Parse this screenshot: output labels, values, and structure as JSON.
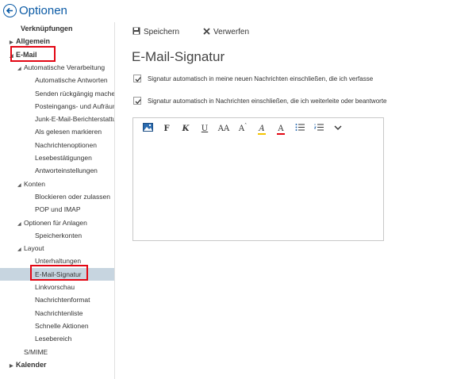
{
  "header": {
    "title": "Optionen"
  },
  "sidebar": {
    "items": [
      {
        "label": "Verknüpfungen",
        "level": 0,
        "bold": true,
        "arrow": "",
        "top": 0
      },
      {
        "label": "Allgemein",
        "level": 0,
        "bold": true,
        "arrow": "▶"
      },
      {
        "label": "E-Mail",
        "level": 0,
        "bold": true,
        "arrow": "◢"
      },
      {
        "label": "Automatische Verarbeitung",
        "level": 1,
        "arrow": "◢"
      },
      {
        "label": "Automatische Antworten",
        "level": 2
      },
      {
        "label": "Senden rückgängig machen",
        "level": 2
      },
      {
        "label": "Posteingangs- und Aufräumregeln",
        "level": 2
      },
      {
        "label": "Junk-E-Mail-Berichterstattung",
        "level": 2
      },
      {
        "label": "Als gelesen markieren",
        "level": 2
      },
      {
        "label": "Nachrichtenoptionen",
        "level": 2
      },
      {
        "label": "Lesebestätigungen",
        "level": 2
      },
      {
        "label": "Antworteinstellungen",
        "level": 2
      },
      {
        "label": "Konten",
        "level": 1,
        "arrow": "◢"
      },
      {
        "label": "Blockieren oder zulassen",
        "level": 2
      },
      {
        "label": "POP und IMAP",
        "level": 2
      },
      {
        "label": "Optionen für Anlagen",
        "level": 1,
        "arrow": "◢"
      },
      {
        "label": "Speicherkonten",
        "level": 2
      },
      {
        "label": "Layout",
        "level": 1,
        "arrow": "◢"
      },
      {
        "label": "Unterhaltungen",
        "level": 2
      },
      {
        "label": "E-Mail-Signatur",
        "level": 2,
        "selected": true
      },
      {
        "label": "Linkvorschau",
        "level": 2
      },
      {
        "label": "Nachrichtenformat",
        "level": 2
      },
      {
        "label": "Nachrichtenliste",
        "level": 2
      },
      {
        "label": "Schnelle Aktionen",
        "level": 2
      },
      {
        "label": "Lesebereich",
        "level": 2
      },
      {
        "label": "S/MIME",
        "level": 1
      },
      {
        "label": "Kalender",
        "level": 0,
        "bold": true,
        "arrow": "▶"
      }
    ]
  },
  "toolbar": {
    "save_label": "Speichern",
    "discard_label": "Verwerfen"
  },
  "main": {
    "title": "E-Mail-Signatur",
    "option1": "Signatur automatisch in meine neuen Nachrichten einschließen, die ich verfasse",
    "option2": "Signatur automatisch in Nachrichten einschließen, die ich weiterleite oder beantworte",
    "option1_checked": true,
    "option2_checked": true
  },
  "format_toolbar": {
    "bold": "F",
    "italic": "K",
    "underline": "U",
    "font_size": "AA",
    "grow": "A",
    "highlight": "A",
    "font_color": "A"
  },
  "colors": {
    "accent": "#0a5aa5",
    "highlight_box": "#e30613",
    "selected_bg": "#c7d5e0"
  }
}
